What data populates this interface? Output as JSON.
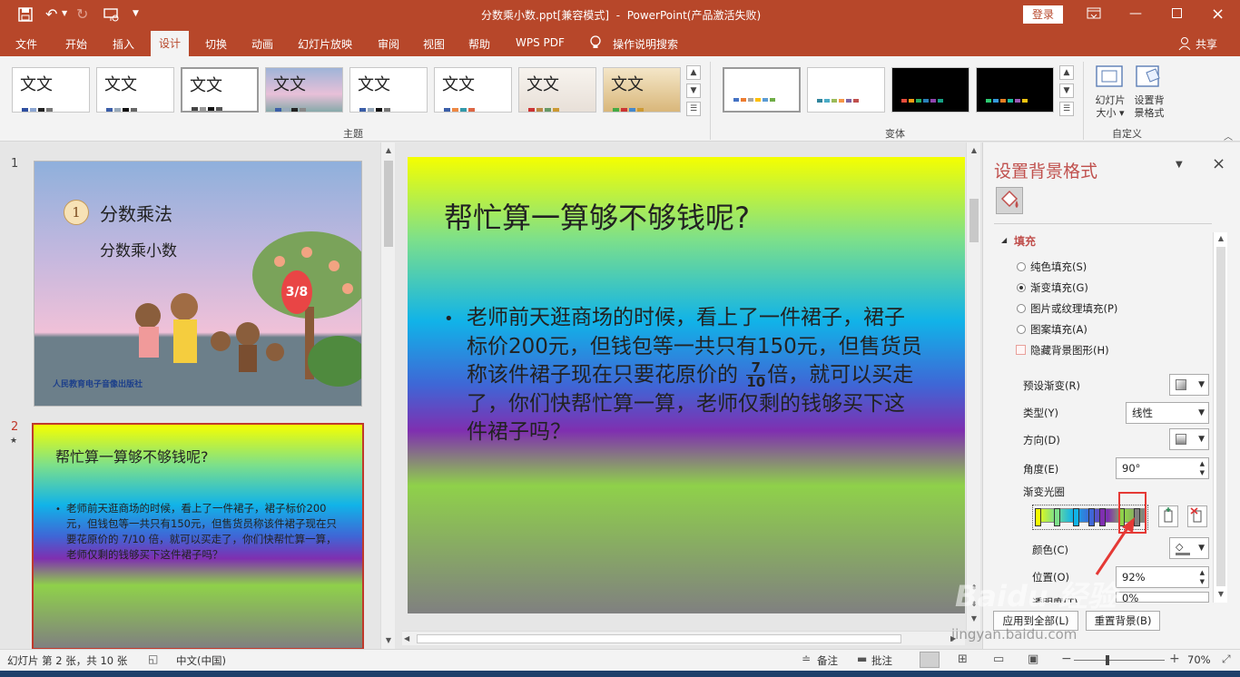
{
  "titlebar": {
    "title": "分数乘小数.ppt[兼容模式]  -  PowerPoint(产品激活失败)",
    "login_label": "登录",
    "icons": [
      "save-icon",
      "undo-icon",
      "redo-icon",
      "present-icon",
      "customize-icon",
      "restore-icon",
      "minimize-icon",
      "maximize-icon",
      "close-icon"
    ]
  },
  "menu": {
    "tabs": [
      "文件",
      "开始",
      "插入",
      "设计",
      "切换",
      "动画",
      "幻灯片放映",
      "审阅",
      "视图",
      "帮助",
      "WPS PDF",
      "操作说明搜索"
    ],
    "active": "设计",
    "share_label": "共享"
  },
  "ribbon": {
    "theme_label": "文文",
    "theme_group_label": "主题",
    "variant_group_label": "变体",
    "customize_group_label": "自定义",
    "slide_size_label": "幻灯片大小",
    "format_bg_label": "设置背景格式",
    "theme_colors": [
      [
        "#2f4fa0",
        "#8da7d3",
        "#222",
        "#777"
      ],
      [
        "#3b5ea8",
        "#9ab",
        "#111",
        "#666"
      ],
      [
        "#444",
        "#999",
        "#111",
        "#555"
      ],
      [
        "#3b5ea8",
        "#9ab",
        "#222",
        "#888"
      ],
      [
        "#3b5ea8",
        "#9ab",
        "#111",
        "#777"
      ],
      [
        "#3b5ea8",
        "#e84",
        "#39a",
        "#d64"
      ],
      [
        "#c33",
        "#b84",
        "#696",
        "#c93"
      ],
      [
        "#4a4",
        "#c33",
        "#48c",
        "#c93"
      ]
    ],
    "variant_colors": [
      [
        "#4472c4",
        "#ed7d31",
        "#a5a5a5",
        "#ffc000",
        "#5b9bd5",
        "#70ad47"
      ],
      [
        "#31859c",
        "#4bacc6",
        "#9bbb59",
        "#f79646",
        "#8064a2",
        "#c0504d"
      ],
      [
        "#e74c3c",
        "#f39c12",
        "#27ae60",
        "#2980b9",
        "#8e44ad",
        "#16a085"
      ],
      [
        "#2ecc71",
        "#3498db",
        "#e67e22",
        "#1abc9c",
        "#9b59b6",
        "#f1c40f"
      ]
    ]
  },
  "thumbnails": [
    {
      "number": "1",
      "title": "分数乘法",
      "subtitle": "分数乘小数",
      "badge": "1",
      "fraction": "3/8",
      "publisher": "人民教育电子音像出版社"
    },
    {
      "number": "2",
      "star": "★",
      "title": "帮忙算一算够不够钱呢?",
      "body": "老师前天逛商场的时候，看上了一件裙子，裙子标价200元，但钱包等一共只有150元，但售货员称该件裙子现在只要花原价的 7/10 倍，就可以买走了，你们快帮忙算一算，老师仅剩的钱够买下这件裙子吗？"
    }
  ],
  "slide": {
    "title": "帮忙算一算够不够钱呢?",
    "bullet": "•",
    "line1": "老师前天逛商场的时候，看上了一件裙子，裙子",
    "line2a": "标价200元，但钱包等一共只有",
    "line2b": "150元，但售货员",
    "line3a": "称该件裙子现在只要花原价的",
    "line3b": "倍，就可以买走",
    "line4": "了，你们快帮忙算一算，老师仅剩的钱够买下这",
    "line5": "件裙子吗？",
    "frac_num": "7",
    "frac_den": "10"
  },
  "pane": {
    "title": "设置背景格式",
    "section": "填充",
    "options": [
      "纯色填充(S)",
      "渐变填充(G)",
      "图片或纹理填充(P)",
      "图案填充(A)"
    ],
    "selected": "渐变填充(G)",
    "hide_bg_label": "隐藏背景图形(H)",
    "preset_label": "预设渐变(R)",
    "type_label": "类型(Y)",
    "type_value": "线性",
    "direction_label": "方向(D)",
    "angle_label": "角度(E)",
    "angle_value": "90°",
    "stops_label": "渐变光圈",
    "color_label": "颜色(C)",
    "position_label": "位置(O)",
    "position_value": "92%",
    "transparency_label": "透明度(T)",
    "transparency_value": "0%",
    "apply_all_label": "应用到全部(L)",
    "reset_label": "重置背景(B)",
    "stop_colors": [
      "#f5ff00",
      "#7de08a",
      "#11b3e8",
      "#3f66d6",
      "#7f2fb0",
      "#8fd14a",
      "#808080"
    ]
  },
  "status": {
    "slide_info": "幻灯片 第 2 张，共 10 张",
    "language": "中文(中国)",
    "notes_label": "备注",
    "comments_label": "批注",
    "zoom": "70%",
    "zoom_level": 0.7
  },
  "watermark": "Baidu 经验",
  "watermark_url": "jingyan.baidu.com"
}
